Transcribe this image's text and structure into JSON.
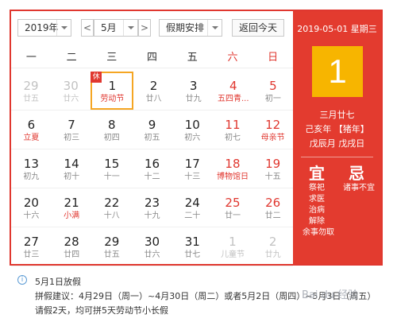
{
  "toolbar": {
    "year": "2019年",
    "month": "5月",
    "holiday": "假期安排",
    "prev": "<",
    "next": ">",
    "today_btn": "返回今天"
  },
  "weekdays": [
    "一",
    "二",
    "三",
    "四",
    "五",
    "六",
    "日"
  ],
  "rows": [
    [
      {
        "n": "29",
        "l": "廿五"
      },
      {
        "n": "30",
        "l": "廿六"
      },
      {
        "n": "1",
        "l": "劳动节"
      },
      {
        "n": "2",
        "l": "廿八"
      },
      {
        "n": "3",
        "l": "廿九"
      },
      {
        "n": "4",
        "l": "五四青..."
      },
      {
        "n": "5",
        "l": "初一"
      }
    ],
    [
      {
        "n": "6",
        "l": "立夏"
      },
      {
        "n": "7",
        "l": "初三"
      },
      {
        "n": "8",
        "l": "初四"
      },
      {
        "n": "9",
        "l": "初五"
      },
      {
        "n": "10",
        "l": "初六"
      },
      {
        "n": "11",
        "l": "初七"
      },
      {
        "n": "12",
        "l": "母亲节"
      }
    ],
    [
      {
        "n": "13",
        "l": "初九"
      },
      {
        "n": "14",
        "l": "初十"
      },
      {
        "n": "15",
        "l": "十一"
      },
      {
        "n": "16",
        "l": "十二"
      },
      {
        "n": "17",
        "l": "十三"
      },
      {
        "n": "18",
        "l": "博物馆日"
      },
      {
        "n": "19",
        "l": "十五"
      }
    ],
    [
      {
        "n": "20",
        "l": "十六"
      },
      {
        "n": "21",
        "l": "小满"
      },
      {
        "n": "22",
        "l": "十八"
      },
      {
        "n": "23",
        "l": "十九"
      },
      {
        "n": "24",
        "l": "二十"
      },
      {
        "n": "25",
        "l": "廿一"
      },
      {
        "n": "26",
        "l": "廿二"
      }
    ],
    [
      {
        "n": "27",
        "l": "廿三"
      },
      {
        "n": "28",
        "l": "廿四"
      },
      {
        "n": "29",
        "l": "廿五"
      },
      {
        "n": "30",
        "l": "廿六"
      },
      {
        "n": "31",
        "l": "廿七"
      },
      {
        "n": "1",
        "l": "儿童节"
      },
      {
        "n": "2",
        "l": "廿九"
      }
    ]
  ],
  "holiday_badge": "休",
  "side": {
    "date": "2019-05-01 星期三",
    "day": "1",
    "lunar": "三月廿七",
    "ganzhi_year": "己亥年 【猪年】",
    "ganzhi_md": "戊辰月 戊戌日",
    "yi": "宜",
    "ji": "忌",
    "yi_items": [
      "祭祀",
      "求医",
      "治病",
      "解除",
      "余事勿取"
    ],
    "ji_items": [
      "诸事不宜"
    ]
  },
  "note": {
    "icon": "i",
    "line1": "5月1日放假",
    "line2": "拼假建议：4月29日（周一）~4月30日（周二）或者5月2日（周四）~5月3日（周五）",
    "line3": "请假2天，均可拼5天劳动节小长假"
  },
  "watermark": "Bai du 经验",
  "colors": {
    "accent": "#e33b2f",
    "highlight": "#f7b500",
    "selected_border": "#f5a623"
  }
}
